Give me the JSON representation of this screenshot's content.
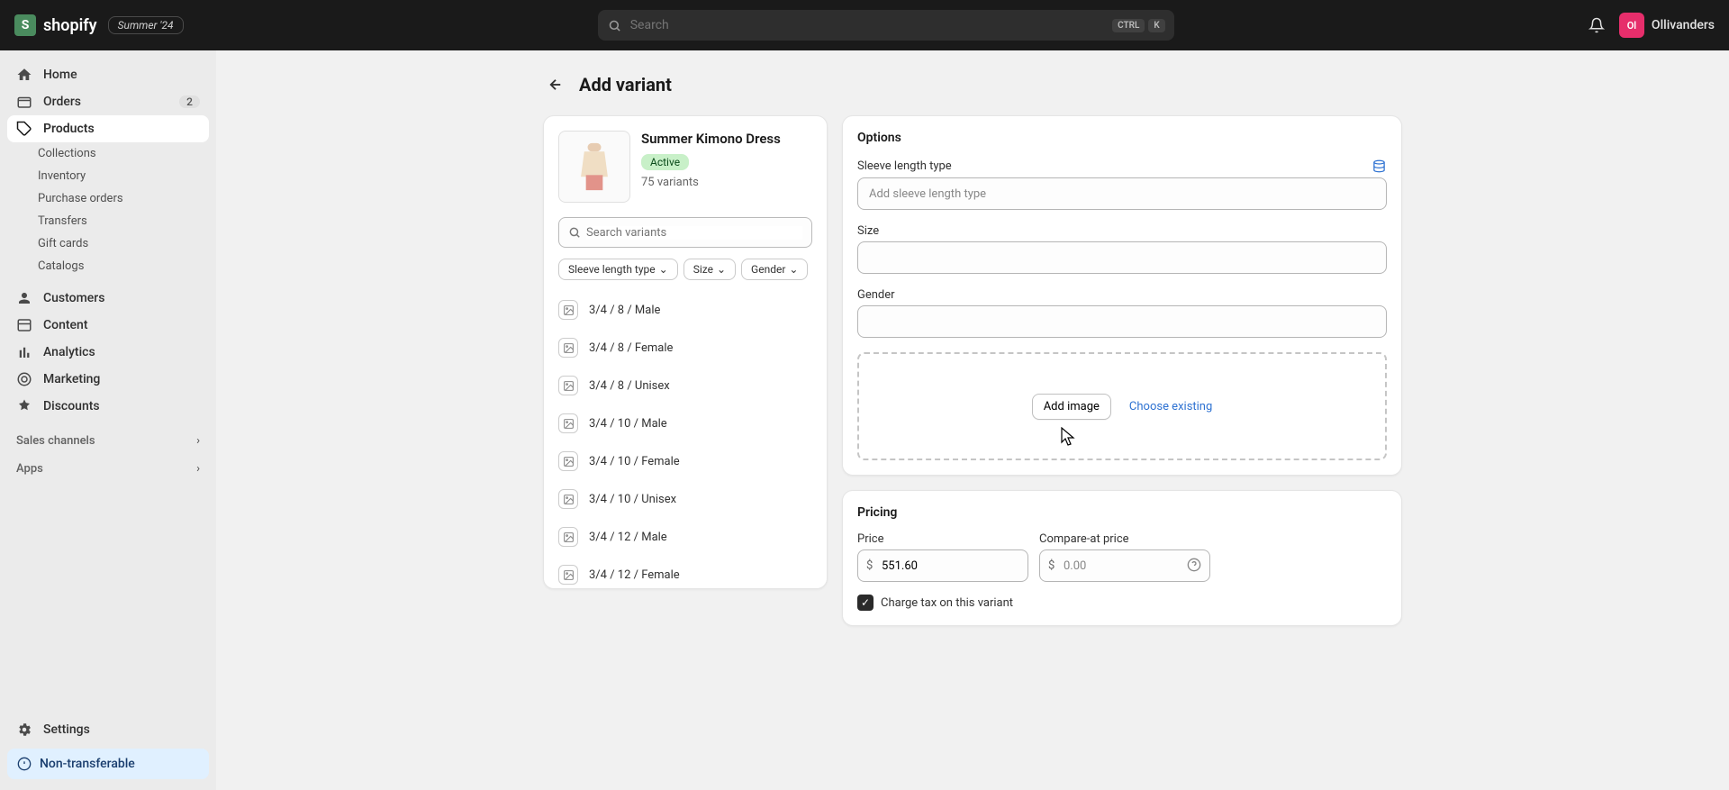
{
  "header": {
    "brand": "shopify",
    "summer_badge": "Summer '24",
    "search_placeholder": "Search",
    "kbd_ctrl": "CTRL",
    "kbd_k": "K",
    "user_initials": "Ol",
    "username": "Ollivanders"
  },
  "sidebar": {
    "home": "Home",
    "orders": "Orders",
    "orders_count": "2",
    "products": "Products",
    "sub_collections": "Collections",
    "sub_inventory": "Inventory",
    "sub_purchase": "Purchase orders",
    "sub_transfers": "Transfers",
    "sub_gift": "Gift cards",
    "sub_catalogs": "Catalogs",
    "customers": "Customers",
    "content": "Content",
    "analytics": "Analytics",
    "marketing": "Marketing",
    "discounts": "Discounts",
    "sales_channels": "Sales channels",
    "apps": "Apps",
    "settings": "Settings",
    "non_transferable": "Non-transferable"
  },
  "page": {
    "title": "Add variant"
  },
  "product": {
    "name": "Summer Kimono Dress",
    "status": "Active",
    "variant_count": "75 variants",
    "search_placeholder": "Search variants",
    "filter1": "Sleeve length type",
    "filter2": "Size",
    "filter3": "Gender",
    "variants": [
      "3/4 / 8 / Male",
      "3/4 / 8 / Female",
      "3/4 / 8 / Unisex",
      "3/4 / 10 / Male",
      "3/4 / 10 / Female",
      "3/4 / 10 / Unisex",
      "3/4 / 12 / Male",
      "3/4 / 12 / Female"
    ]
  },
  "options": {
    "title": "Options",
    "sleeve_label": "Sleeve length type",
    "sleeve_placeholder": "Add sleeve length type",
    "size_label": "Size",
    "gender_label": "Gender",
    "add_image": "Add image",
    "choose_existing": "Choose existing"
  },
  "pricing": {
    "title": "Pricing",
    "price_label": "Price",
    "price_value": "551.60",
    "compare_label": "Compare-at price",
    "compare_placeholder": "0.00",
    "currency": "$",
    "tax_label": "Charge tax on this variant"
  }
}
